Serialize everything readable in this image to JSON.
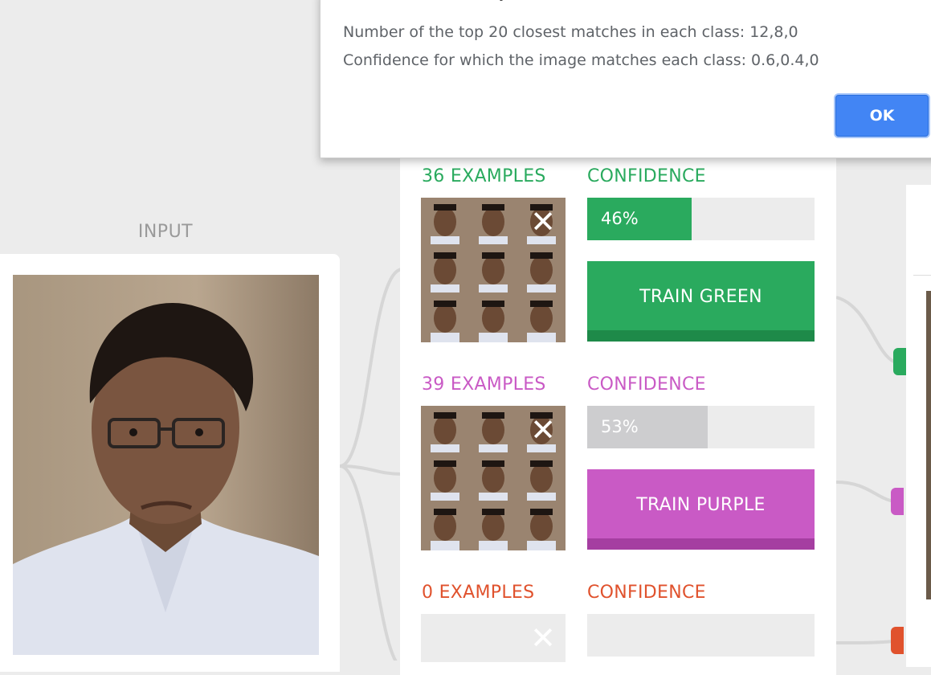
{
  "input": {
    "label": "INPUT"
  },
  "classes": [
    {
      "examples_label": "36 EXAMPLES",
      "confidence_label": "CONFIDENCE",
      "confidence_value": "46%",
      "confidence_fraction": 0.46,
      "button_label": "TRAIN GREEN",
      "color": "#2aaa5e",
      "bar_color": "#2aaa5e",
      "button_shade": "#1e8a49"
    },
    {
      "examples_label": "39 EXAMPLES",
      "confidence_label": "CONFIDENCE",
      "confidence_value": "53%",
      "confidence_fraction": 0.53,
      "button_label": "TRAIN PURPLE",
      "color": "#c95ac5",
      "bar_color": "#cdcdcf",
      "button_shade": "#a53ea1"
    },
    {
      "examples_label": "0 EXAMPLES",
      "confidence_label": "CONFIDENCE",
      "confidence_value": "",
      "confidence_fraction": 0,
      "button_label": "",
      "color": "#e0522d",
      "bar_color": "#e0522d",
      "button_shade": "#b83e1f"
    }
  ],
  "dialog": {
    "title_fragment": "y",
    "line1": "Number of the top 20 closest matches in each class: 12,8,0",
    "line2": "Confidence for which the image matches each class: 0.6,0.4,0",
    "ok_label": "OK"
  },
  "icons": {
    "remove": "close-icon"
  }
}
